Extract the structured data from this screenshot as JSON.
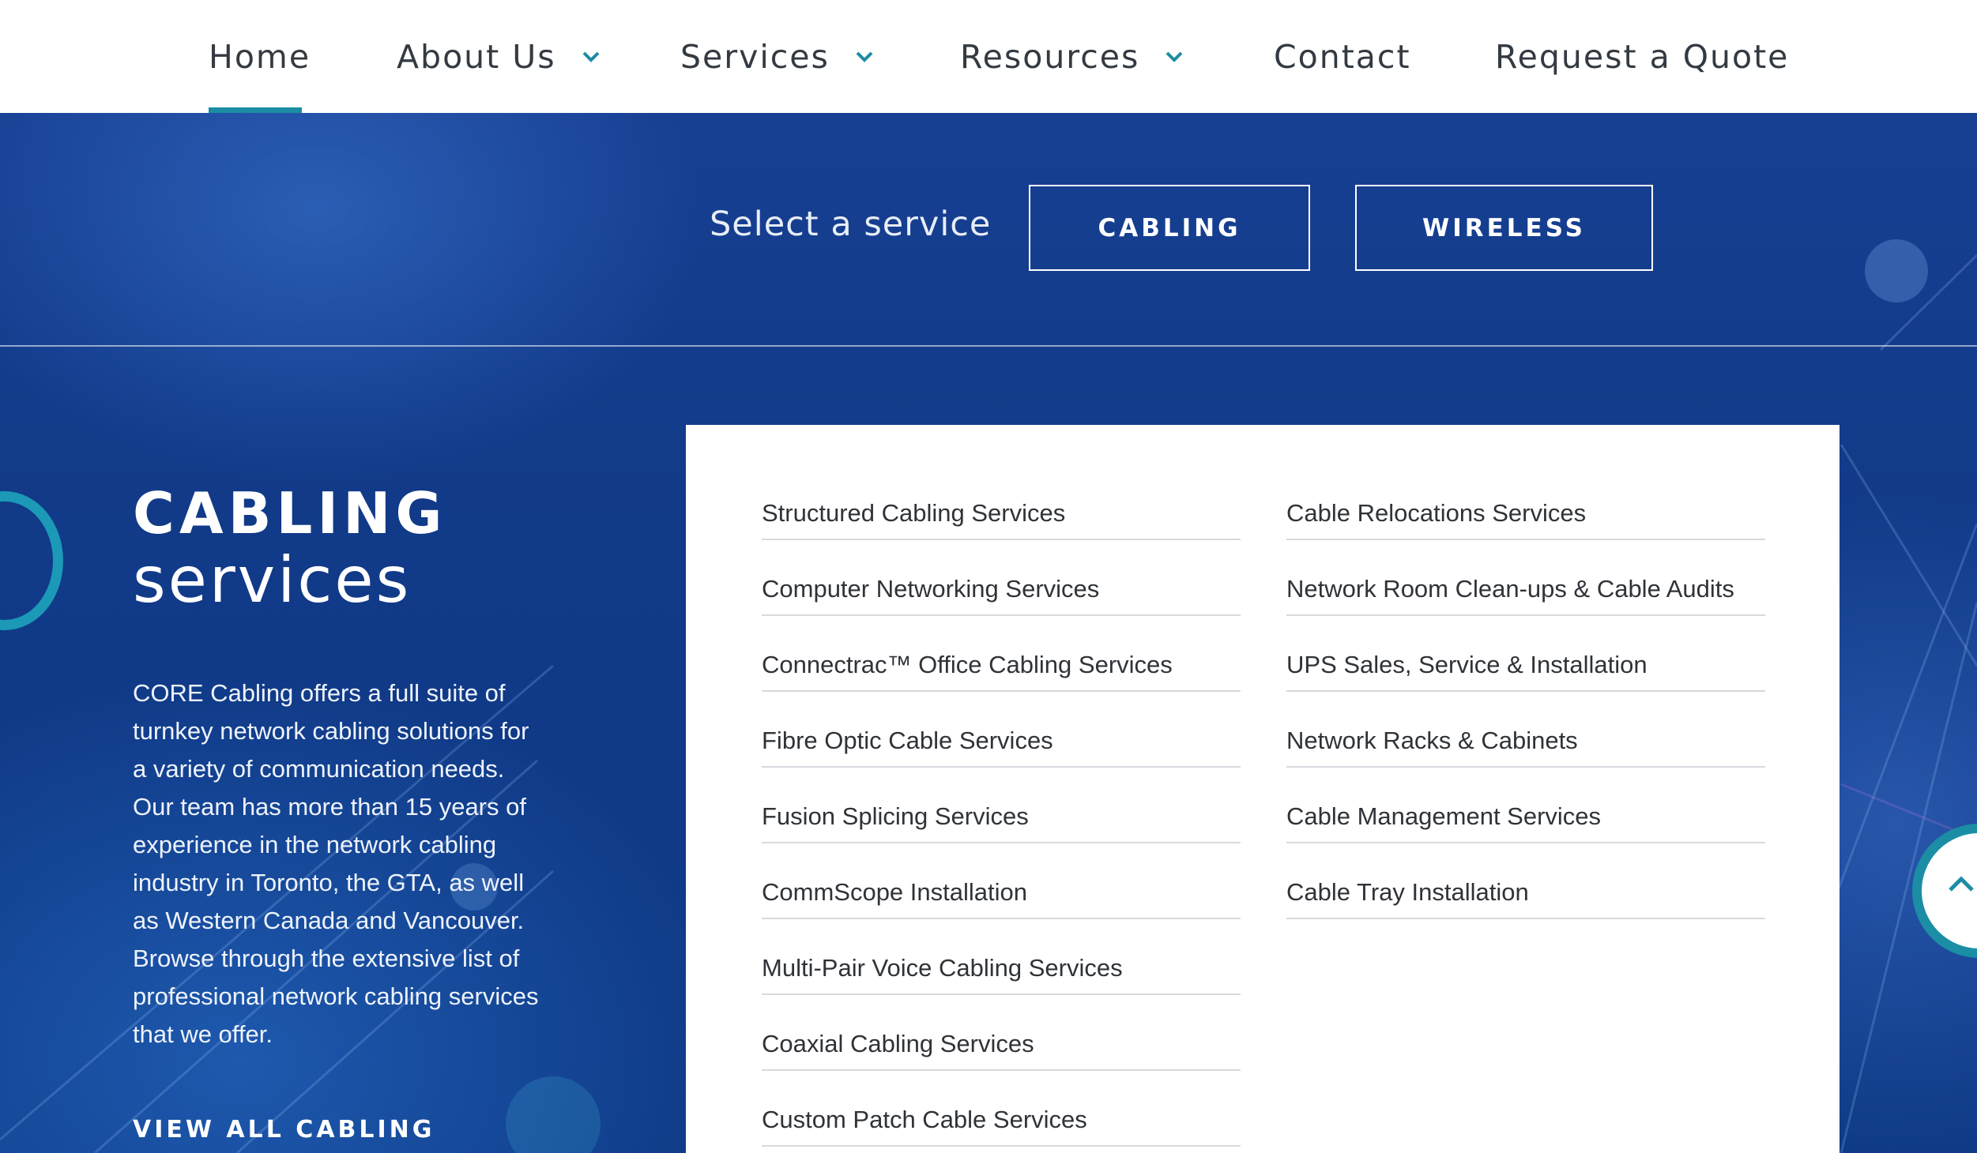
{
  "nav": {
    "items": [
      {
        "label": "Home",
        "has_dropdown": false,
        "active": true
      },
      {
        "label": "About Us",
        "has_dropdown": true
      },
      {
        "label": "Services",
        "has_dropdown": true
      },
      {
        "label": "Resources",
        "has_dropdown": true
      },
      {
        "label": "Contact",
        "has_dropdown": false
      },
      {
        "label": "Request a Quote",
        "has_dropdown": false
      }
    ],
    "accent_color": "#1c8da4"
  },
  "service_select": {
    "label": "Select a service",
    "buttons": [
      "CABLING",
      "WIRELESS"
    ]
  },
  "section": {
    "title_line1": "CABLING",
    "title_line2": "services",
    "description": "CORE Cabling offers a full suite of turnkey network cabling solutions for a variety of communication needs. Our team has more than 15 years of experience in the network cabling industry in Toronto, the GTA, as well as Western Canada and Vancouver. Browse through the extensive list of professional network cabling services that we offer.",
    "view_all": "VIEW ALL CABLING"
  },
  "services": {
    "left": [
      "Structured Cabling Services",
      "Computer Networking Services",
      "Connectrac™ Office Cabling Services",
      "Fibre Optic Cable Services",
      "Fusion Splicing Services",
      "CommScope Installation",
      "Multi-Pair Voice Cabling Services",
      "Coaxial Cabling Services",
      "Custom Patch Cable Services"
    ],
    "right": [
      "Cable Relocations Services",
      "Network Room Clean-ups & Cable Audits",
      "UPS Sales, Service & Installation",
      "Network Racks & Cabinets",
      "Cable Management Services",
      "Cable Tray Installation"
    ]
  },
  "colors": {
    "hero_bg": "#0f3f8c",
    "accent_teal": "#1b99b6"
  },
  "icons": {
    "dropdown": "chevron-down-icon",
    "scroll_top": "chevron-up-icon"
  }
}
